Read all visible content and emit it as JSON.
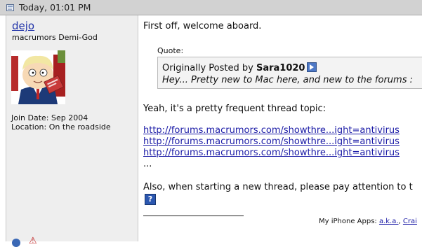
{
  "post": {
    "date": "Today, 01:01 PM",
    "author": {
      "username": "dejo",
      "title": "macrumors Demi-God",
      "join_date": "Join Date: Sep 2004",
      "location": "Location: On the roadside"
    },
    "body": {
      "intro": "First off, welcome aboard.",
      "quote_label": "Quote:",
      "quote_originally": "Originally Posted by ",
      "quote_author": "Sara1020",
      "quote_text": "Hey... Pretty new to Mac here, and new to the forums :",
      "reply": "Yeah, it's a pretty frequent thread topic:",
      "links": [
        "http://forums.macrumors.com/showthre...ight=antivirus",
        "http://forums.macrumors.com/showthre...ight=antivirus",
        "http://forums.macrumors.com/showthre...ight=antivirus"
      ],
      "ellipsis": "...",
      "closing": "Also, when starting a new thread, please pay attention to t",
      "help_glyph": "?"
    },
    "signature": {
      "label": "My iPhone Apps: ",
      "app1": "a.k.a.",
      "sep": ", ",
      "app2": "Crai"
    }
  },
  "icons": [
    "post-icon",
    "view-post-icon",
    "help-icon",
    "online-status-icon",
    "report-icon"
  ],
  "colors": {
    "link": "#1a1aa6",
    "username": "#1f31a8",
    "header_bg": "#d2d2d2",
    "sidebar_bg": "#eeeeee"
  }
}
